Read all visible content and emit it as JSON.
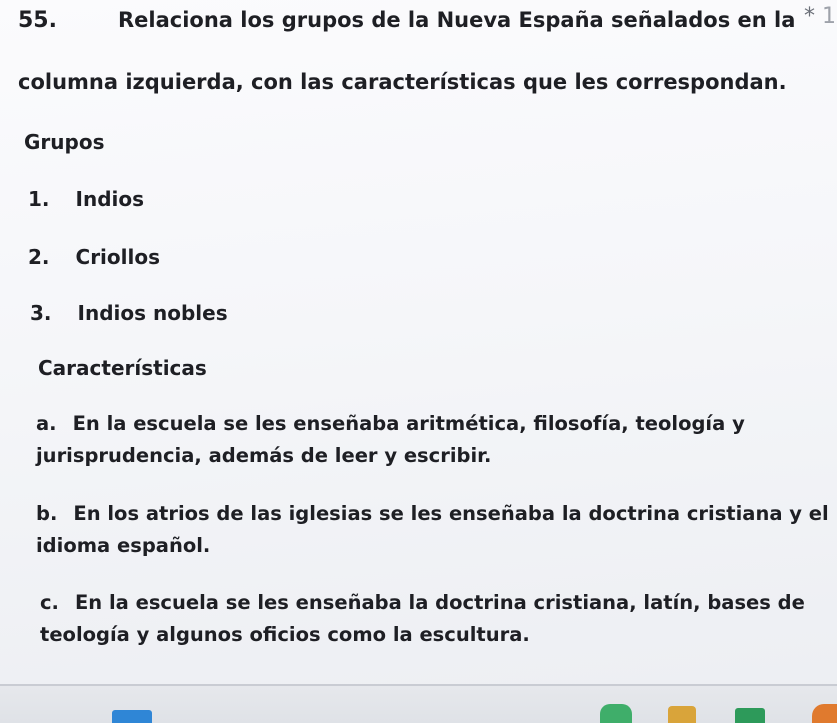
{
  "question": {
    "number": "55.",
    "line1": "Relaciona los grupos de la Nueva España señalados en la",
    "line2": "columna izquierda, con las características que les correspondan.",
    "required_marker": "*",
    "required_tail": "1"
  },
  "groups": {
    "heading": "Grupos",
    "items": [
      {
        "num": "1.",
        "text": "Indios"
      },
      {
        "num": "2.",
        "text": "Criollos"
      },
      {
        "num": "3.",
        "text": "Indios nobles"
      }
    ]
  },
  "characteristics": {
    "heading": "Características",
    "items": [
      {
        "label": "a.",
        "line1": "En la escuela se les enseñaba aritmética, filosofía, teología y",
        "line2": "jurisprudencia, además de leer y escribir."
      },
      {
        "label": "b.",
        "line1": "En los atrios de las iglesias se les enseñaba la doctrina cristiana y el",
        "line2": "idioma español."
      },
      {
        "label": "c.",
        "line1": "En la escuela se les enseñaba la doctrina cristiana, latín, bases de",
        "line2": "teología y algunos oficios como la escultura."
      }
    ]
  },
  "colors": {
    "text": "#1e1f24",
    "required": "#6b6f78"
  }
}
